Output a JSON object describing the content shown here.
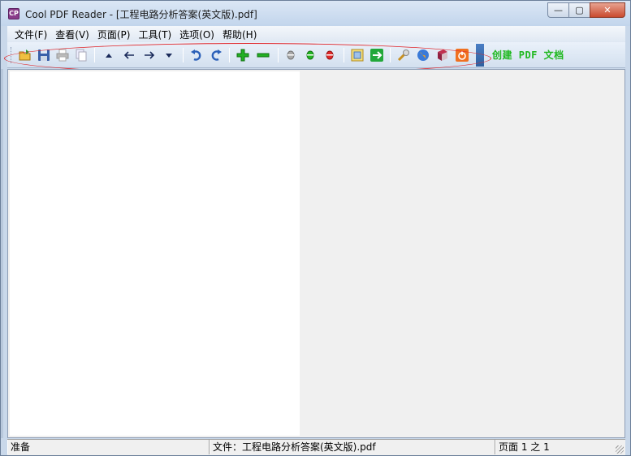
{
  "window": {
    "title": "Cool PDF Reader - [工程电路分析答案(英文版).pdf]",
    "app_icon_text": "CP"
  },
  "controls": {
    "minimize": "—",
    "maximize": "▢",
    "close": "✕"
  },
  "menu": {
    "items": [
      {
        "label": "文件(F)"
      },
      {
        "label": "查看(V)"
      },
      {
        "label": "页面(P)"
      },
      {
        "label": "工具(T)"
      },
      {
        "label": "选项(O)"
      },
      {
        "label": "帮助(H)"
      }
    ]
  },
  "toolbar": {
    "create_pdf_label": "创建 PDF 文档",
    "accent_color": "#1fb81f",
    "highlight_color": "#e0272b"
  },
  "status": {
    "ready": "准备",
    "file": "文件：工程电路分析答案(英文版).pdf",
    "page": "页面 1 之 1"
  }
}
